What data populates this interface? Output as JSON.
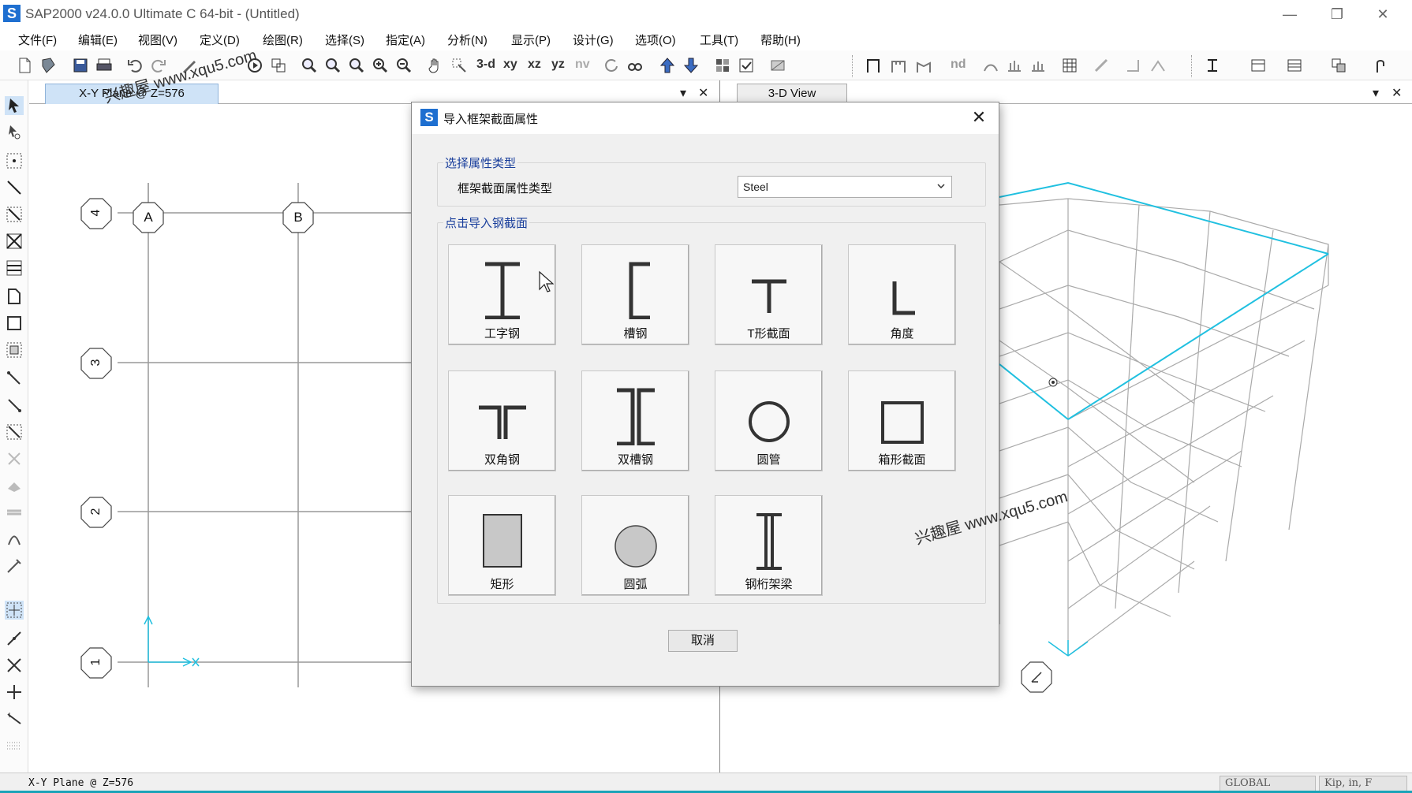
{
  "window": {
    "title": "SAP2000 v24.0.0 Ultimate C 64-bit - (Untitled)",
    "logo_letter": "S",
    "minimize": "—",
    "restore": "❐",
    "close": "✕"
  },
  "menu": [
    "文件(F)",
    "编辑(E)",
    "视图(V)",
    "定义(D)",
    "绘图(R)",
    "选择(S)",
    "指定(A)",
    "分析(N)",
    "显示(P)",
    "设计(G)",
    "选项(O)",
    "工具(T)",
    "帮助(H)"
  ],
  "toolbar": {
    "view_buttons": [
      "3-d",
      "xy",
      "xz",
      "yz",
      "nv"
    ],
    "nd_label": "nd"
  },
  "left_pane": {
    "tab_label": "X-Y Plane @ Z=576",
    "grid_x": [
      "A",
      "B"
    ],
    "grid_y": [
      "4",
      "3",
      "2",
      "1"
    ],
    "dropdown_glyph": "▾",
    "close_glyph": "✕"
  },
  "right_pane": {
    "tab_label": "3-D View",
    "dropdown_glyph": "▾",
    "close_glyph": "✕"
  },
  "dialog": {
    "title": "导入框架截面属性",
    "logo_letter": "S",
    "close_glyph": "✕",
    "group1_label": "选择属性类型",
    "field_label": "框架截面属性类型",
    "select_value": "Steel",
    "group2_label": "点击导入钢截面",
    "sections": [
      {
        "label": "工字钢",
        "icon": "i-beam-icon"
      },
      {
        "label": "槽钢",
        "icon": "channel-icon"
      },
      {
        "label": "T形截面",
        "icon": "tee-section-icon"
      },
      {
        "label": "角度",
        "icon": "angle-section-icon"
      },
      {
        "label": "双角钢",
        "icon": "double-angle-icon"
      },
      {
        "label": "双槽钢",
        "icon": "double-channel-icon"
      },
      {
        "label": "圆管",
        "icon": "pipe-icon"
      },
      {
        "label": "箱形截面",
        "icon": "box-section-icon"
      },
      {
        "label": "矩形",
        "icon": "rectangle-section-icon"
      },
      {
        "label": "圆弧",
        "icon": "circle-section-icon"
      },
      {
        "label": "钢桁架梁",
        "icon": "steel-joist-icon"
      }
    ],
    "cancel_label": "取消"
  },
  "status": {
    "text": "X-Y Plane @ Z=576",
    "coord_system": "GLOBAL",
    "units": "Kip, in, F"
  },
  "watermark": "兴趣屋 www.xqu5.com",
  "colors": {
    "tab_active": "#cfe3f7",
    "dialog_bg": "#f0f0f0",
    "group_label": "#1a3f9c",
    "axis_cyan": "#20c0e0"
  }
}
